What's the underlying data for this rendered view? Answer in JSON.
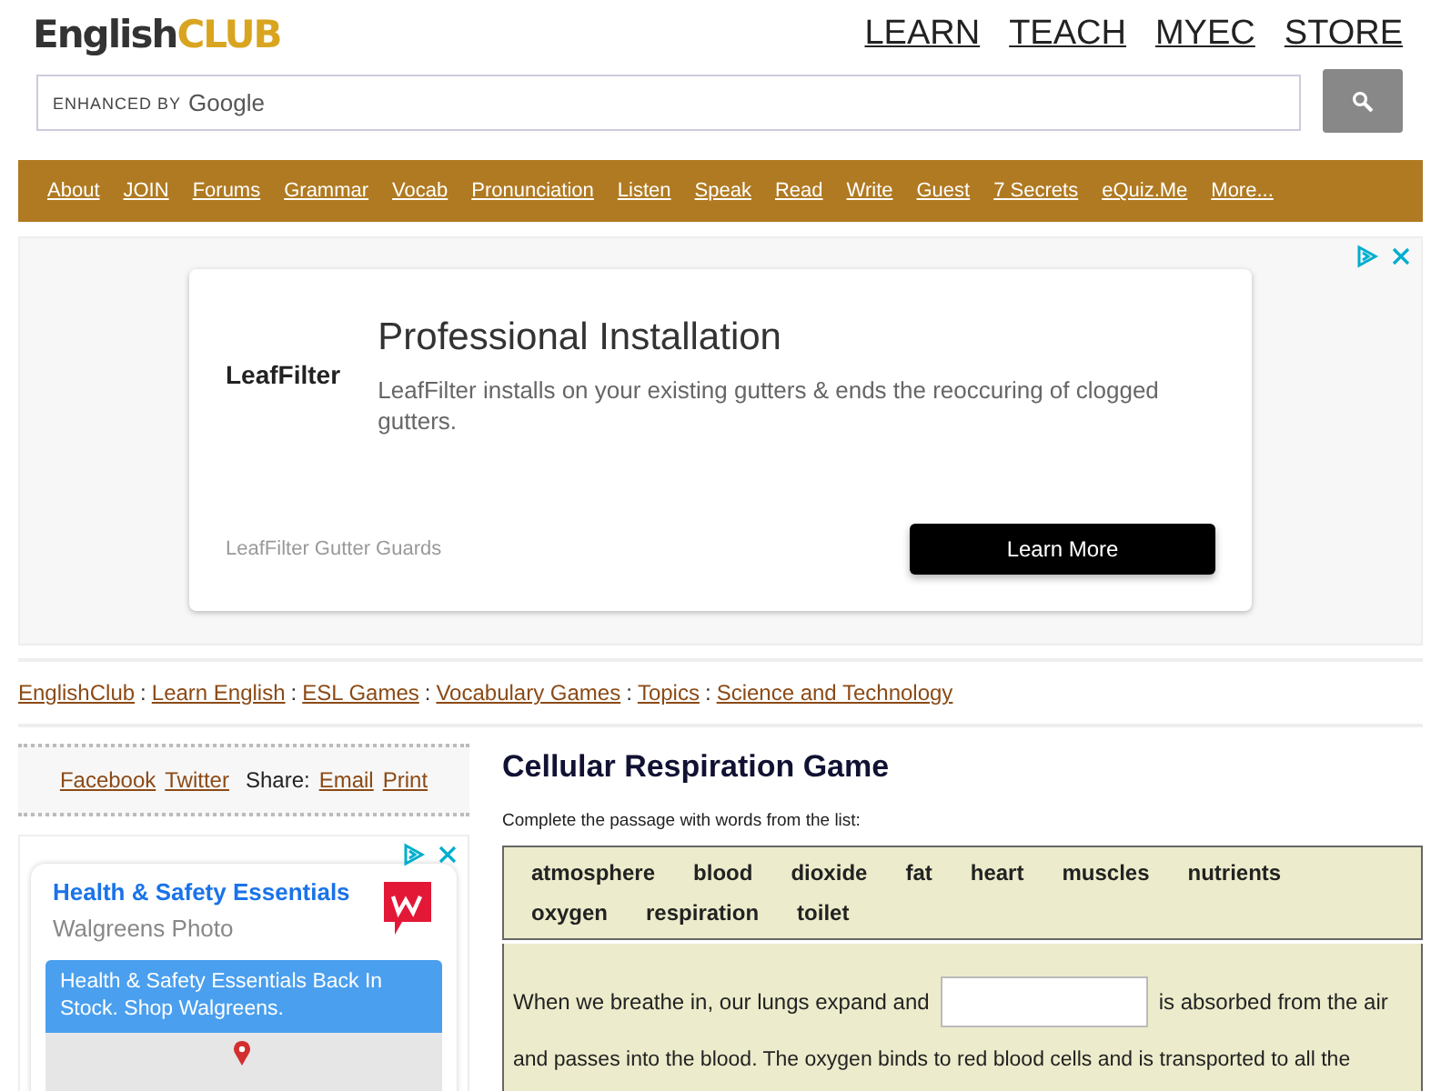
{
  "logo": {
    "part_1": "English",
    "part_2": "CLUB"
  },
  "top_links": [
    "LEARN",
    "TEACH",
    "MYEC",
    "STORE"
  ],
  "search": {
    "placeholder_prefix": "ENHANCED BY",
    "placeholder_brand": "Google"
  },
  "nav": [
    "About",
    "JOIN",
    "Forums",
    "Grammar",
    "Vocab",
    "Pronunciation",
    "Listen",
    "Speak",
    "Read",
    "Write",
    "Guest",
    "7 Secrets",
    "eQuiz.Me",
    "More..."
  ],
  "top_ad": {
    "logo_text": "LeafFilter",
    "title": "Professional Installation",
    "text": "LeafFilter installs on your existing gutters & ends the reoccuring of clogged gutters.",
    "advertiser": "LeafFilter Gutter Guards",
    "button": "Learn More"
  },
  "breadcrumb": [
    "EnglishClub",
    "Learn English",
    "ESL Games",
    "Vocabulary Games",
    "Topics",
    "Science and Technology"
  ],
  "breadcrumb_separator": ":",
  "share": {
    "links": [
      "Facebook",
      "Twitter"
    ],
    "label": "Share:",
    "actions": [
      "Email",
      "Print"
    ]
  },
  "side_ad": {
    "title": "Health & Safety Essentials",
    "advertiser": "Walgreens Photo",
    "banner": "Health & Safety Essentials Back In Stock. Shop Walgreens."
  },
  "game": {
    "title": "Cellular Respiration Game",
    "instruction": "Complete the passage with words from the list:",
    "words": [
      "atmosphere",
      "blood",
      "dioxide",
      "fat",
      "heart",
      "muscles",
      "nutrients",
      "oxygen",
      "respiration",
      "toilet"
    ],
    "passage_before": "When we breathe in, our lungs expand and",
    "passage_after": "is absorbed from the air",
    "passage_next": "and passes into the blood. The oxygen binds to red blood cells and is transported to all the"
  }
}
